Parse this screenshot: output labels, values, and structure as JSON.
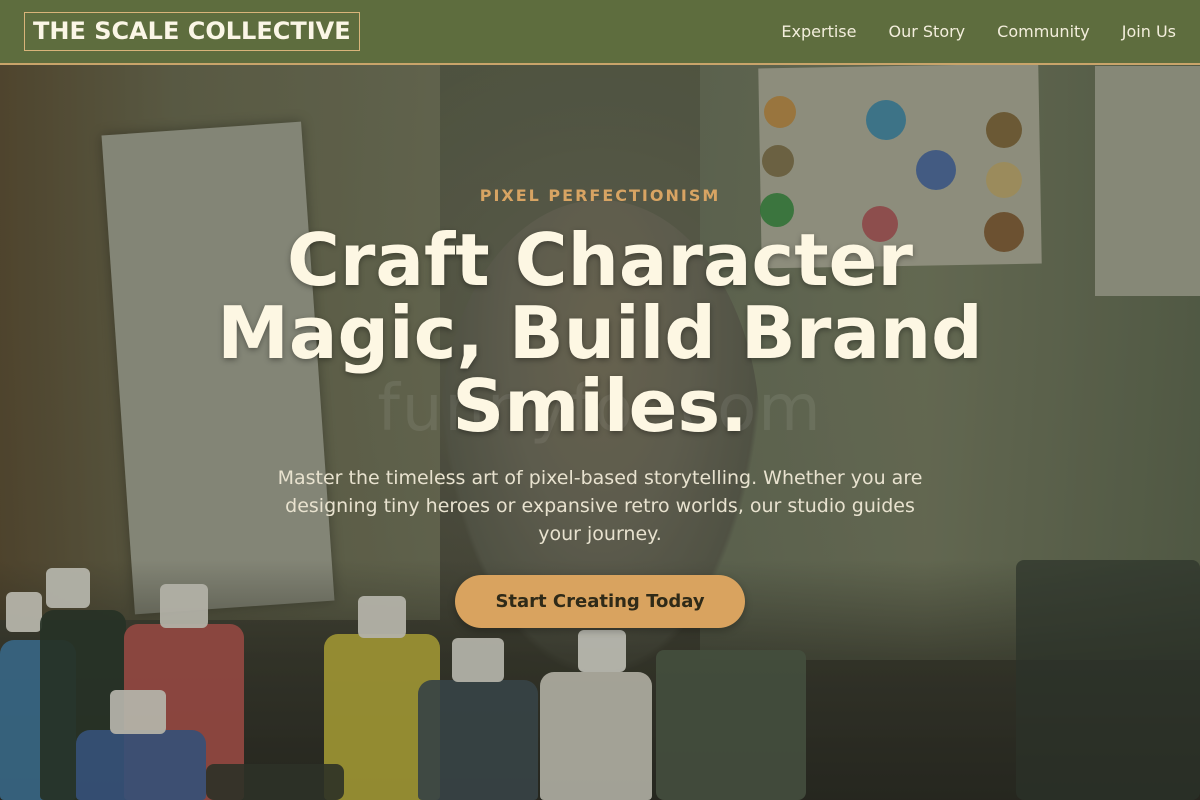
{
  "header": {
    "logo": "THE SCALE COLLECTIVE",
    "nav": [
      {
        "label": "Expertise"
      },
      {
        "label": "Our Story"
      },
      {
        "label": "Community"
      },
      {
        "label": "Join Us"
      }
    ]
  },
  "hero": {
    "eyebrow": "PIXEL PERFECTIONISM",
    "headline": "Craft Character Magic, Build Brand Smiles.",
    "subtext": "Master the timeless art of pixel-based storytelling. Whether you are designing tiny heroes or expansive retro worlds, our studio guides your journey.",
    "cta_label": "Start Creating Today",
    "background_image": "art-studio-paint-photo",
    "watermark": "funnyfor.com"
  },
  "colors": {
    "header_bg": "#5e6d3e",
    "header_border": "#c9a46a",
    "accent": "#d9a35f",
    "eyebrow": "#d8a463",
    "headline": "#fdf7e3",
    "subtext": "#e8e2cf"
  }
}
